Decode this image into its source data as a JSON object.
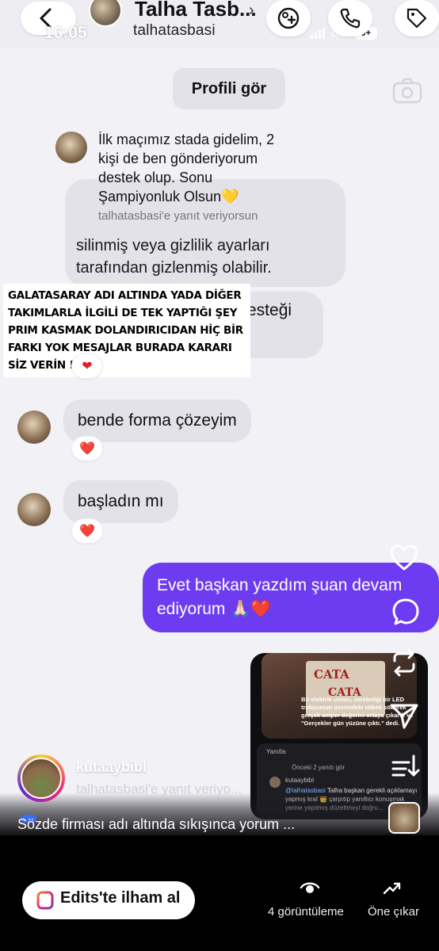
{
  "status_bar": {
    "time": "16:05",
    "network": "LTE",
    "battery": "9+"
  },
  "header": {
    "display_name": "Talha Tasb...",
    "username": "talhatasbasi"
  },
  "profile_button": "Profili gör",
  "reply_quote": {
    "text": "İlk maçımız stada gidelim, 2 kişi de ben gönderiyorum destek olup. Sonu Şampiyonluk Olsun💛",
    "subtext": "talhatasbasi'e yanıt veriyorsun"
  },
  "hidden_message": {
    "text": "silinmiş veya gizlilik ayarları tarafından gizlenmiş olabilir.",
    "partial_text": "esteği"
  },
  "overlay_note": "GALATASARAY ADI ALTINDA YADA DİĞER TAKIMLARLA İLGİLİ DE TEK YAPTIĞI ŞEY PRIM KASMAK DOLANDIRICIDAN HİÇ BİR FARKI YOK MESAJLAR BURADA KARARI SİZ VERİN !",
  "messages": [
    {
      "from": "them",
      "text": "bende forma çözeyim",
      "reaction": "❤️"
    },
    {
      "from": "them",
      "text": "başladın mı",
      "reaction": "❤️"
    },
    {
      "from": "me",
      "text": "Evet başkan yazdım şuan devam ediyorum 🙏🏻❤️"
    }
  ],
  "reel_preview": {
    "brand": "CATA",
    "caption": "Bir elektrik ustası, incelediği bir LED trafosunun üzerindeki etiketi sökerek gerçek amper değerini ortaya çıkardı ve \"Gerçekler gün yüzüne çıktı.\" dedi.",
    "reply_header": "Yanıtla",
    "previous_replies": "Önceki 2 yanıtı gör",
    "comment_user": "kutaaybibl",
    "comment_mention": "@talhatasbasi",
    "comment_text": "Talha başkan gerekli açıklamayı yapmış kral 👑 çarpıtıp yanıltıcı konuşmak yerine yapılmış düzeltmeyi doğru..."
  },
  "reel_info": {
    "username": "kutaaybibl",
    "subtitle": "talhatasbasi'e yanıt veriyo...",
    "caption": "Sözde firması adı altında sıkışınca yorum ..."
  },
  "bottom_bar": {
    "edits_label": "Edits'te ilham al",
    "views_label": "4 görüntüleme",
    "boost_label": "Öne çıkar"
  },
  "icons": [
    "back-chevron-icon",
    "add-people-icon",
    "phone-icon",
    "tag-icon",
    "camera-icon",
    "heart-icon",
    "comment-icon",
    "repost-icon",
    "send-icon",
    "audio-icon",
    "edits-icon",
    "eye-icon",
    "trending-icon"
  ],
  "colors": {
    "background": "#f2f1f6",
    "received_bubble": "#e3e2e9",
    "sent_bubble": "#6e3cf0",
    "reaction_heart": "#e0202e",
    "bottom_bar": "#000000"
  }
}
